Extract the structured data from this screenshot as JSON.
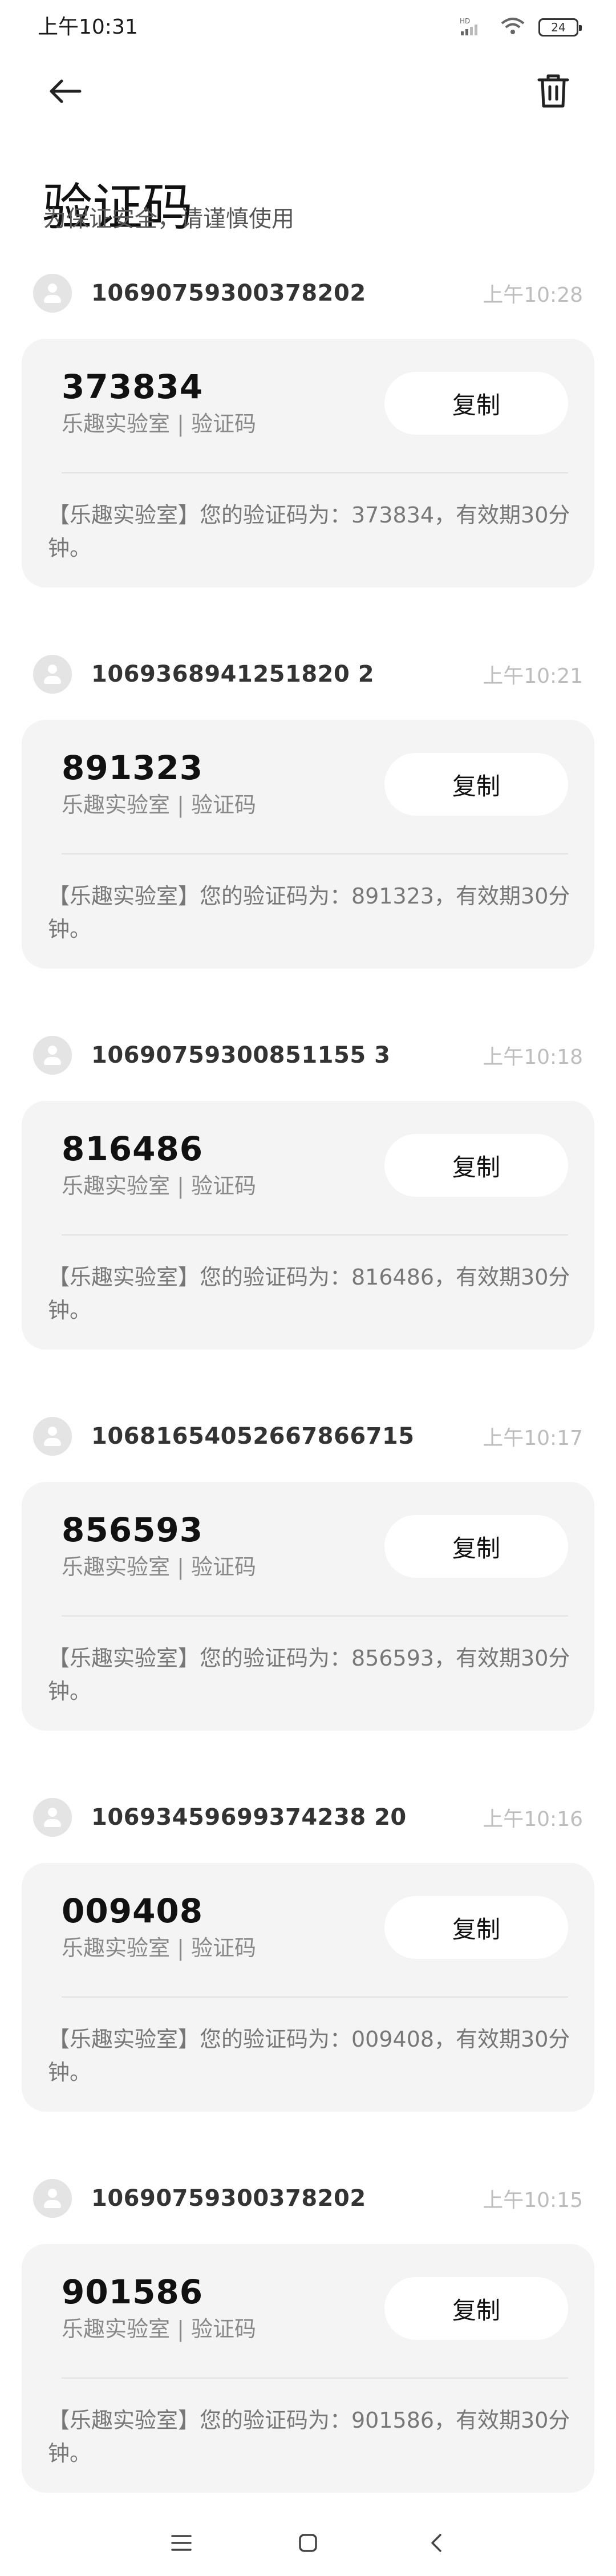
{
  "status_bar": {
    "time": "上午10:31",
    "battery": "24",
    "icons": [
      "hd-signal-icon",
      "wifi-icon",
      "battery-icon"
    ]
  },
  "header": {
    "back_icon": "arrow-left-icon",
    "delete_icon": "trash-icon",
    "title": "验证码",
    "subtitle": "为保证安全，请谨慎使用"
  },
  "messages": [
    {
      "sender": "10690759300378202",
      "time": "上午10:28",
      "code": "373834",
      "source": "乐趣实验室 | 验证码",
      "copy_label": "复制",
      "body": "【乐趣实验室】您的验证码为：373834，有效期30分钟。"
    },
    {
      "sender": "1069368941251820 2",
      "time": "上午10:21",
      "code": "891323",
      "source": "乐趣实验室 | 验证码",
      "copy_label": "复制",
      "body": "【乐趣实验室】您的验证码为：891323，有效期30分钟。"
    },
    {
      "sender": "10690759300851155 3",
      "time": "上午10:18",
      "code": "816486",
      "source": "乐趣实验室 | 验证码",
      "copy_label": "复制",
      "body": "【乐趣实验室】您的验证码为：816486，有效期30分钟。"
    },
    {
      "sender": "10681654052667866715",
      "time": "上午10:17",
      "code": "856593",
      "source": "乐趣实验室 | 验证码",
      "copy_label": "复制",
      "body": "【乐趣实验室】您的验证码为：856593，有效期30分钟。"
    },
    {
      "sender": "10693459699374238 20",
      "time": "上午10:16",
      "code": "009408",
      "source": "乐趣实验室 | 验证码",
      "copy_label": "复制",
      "body": "【乐趣实验室】您的验证码为：009408，有效期30分钟。"
    },
    {
      "sender": "10690759300378202",
      "time": "上午10:15",
      "code": "901586",
      "source": "乐趣实验室 | 验证码",
      "copy_label": "复制",
      "body": "【乐趣实验室】您的验证码为：901586，有效期30分钟。"
    }
  ],
  "nav": {
    "menu_icon": "menu-icon",
    "home_icon": "home-square-icon",
    "back_icon": "chevron-left-icon"
  },
  "colors": {
    "card_background": "#f4f4f4",
    "avatar_background": "#e4e4e4",
    "muted_time": "#bdbdbd"
  }
}
